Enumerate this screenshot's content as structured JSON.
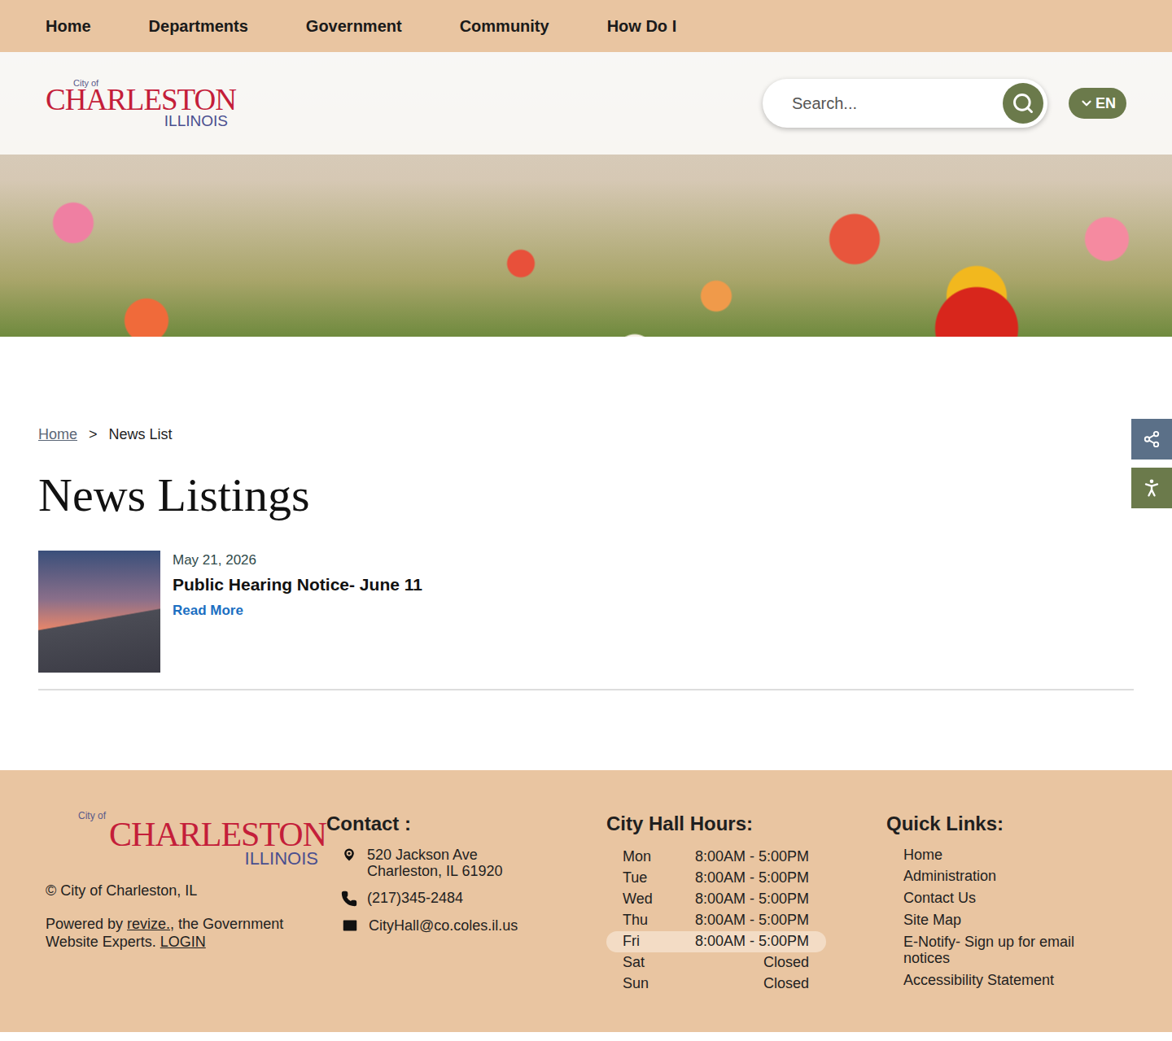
{
  "nav": [
    "Home",
    "Departments",
    "Government",
    "Community",
    "How Do I"
  ],
  "logo": {
    "small": "City of",
    "main": "CHARLESTON",
    "sub": "ILLINOIS"
  },
  "search": {
    "placeholder": "Search..."
  },
  "language": {
    "label": "EN"
  },
  "breadcrumb": {
    "separator": ">",
    "items": [
      {
        "label": "Home",
        "current": false
      },
      {
        "label": "News List",
        "current": true
      }
    ]
  },
  "page_title": "News Listings",
  "news": [
    {
      "date": "May 21, 2026",
      "title": "Public Hearing Notice- June 11",
      "link": "Read More"
    }
  ],
  "footer": {
    "copyright": "© City of Charleston, IL",
    "powered": [
      {
        "text": "Powered by ",
        "link": false
      },
      {
        "text": "revize.",
        "link": true
      },
      {
        "text": ", the Government Website Experts. ",
        "link": false
      },
      {
        "text": "LOGIN",
        "link": true
      }
    ],
    "contact": {
      "heading": "Contact :",
      "address": [
        "520 Jackson Ave",
        "Charleston, IL 61920"
      ],
      "phone": "(217)345-2484",
      "email": "CityHall@co.coles.il.us"
    },
    "hours": {
      "heading": "City Hall Hours:",
      "rows": [
        {
          "day": "Mon",
          "time": "8:00AM - 5:00PM",
          "selected": false
        },
        {
          "day": "Tue",
          "time": "8:00AM - 5:00PM",
          "selected": false
        },
        {
          "day": "Wed",
          "time": "8:00AM - 5:00PM",
          "selected": false
        },
        {
          "day": "Thu",
          "time": "8:00AM - 5:00PM",
          "selected": false
        },
        {
          "day": "Fri",
          "time": "8:00AM - 5:00PM",
          "selected": true
        },
        {
          "day": "Sat",
          "time": "Closed",
          "selected": false
        },
        {
          "day": "Sun",
          "time": "Closed",
          "selected": false
        }
      ]
    },
    "quick_links": {
      "heading": "Quick Links:",
      "items": [
        "Home",
        "Administration",
        "Contact Us",
        "Site Map",
        "E-Notify- Sign up for email notices",
        "Accessibility Statement"
      ]
    }
  }
}
